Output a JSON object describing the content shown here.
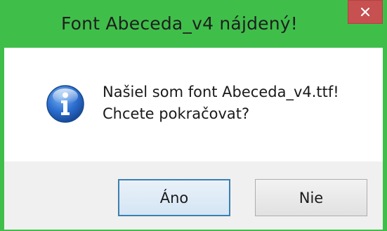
{
  "window": {
    "title": "Font Abeceda_v4 nájdený!",
    "accent_color": "#3fbf4a"
  },
  "close_button": {
    "icon": "close-icon",
    "color": "#c75050"
  },
  "message": {
    "icon": "info-icon",
    "line1": "Našiel som font Abeceda_v4.ttf!",
    "line2": "Chcete pokračovat?"
  },
  "buttons": {
    "yes_label": "Áno",
    "no_label": "Nie"
  }
}
